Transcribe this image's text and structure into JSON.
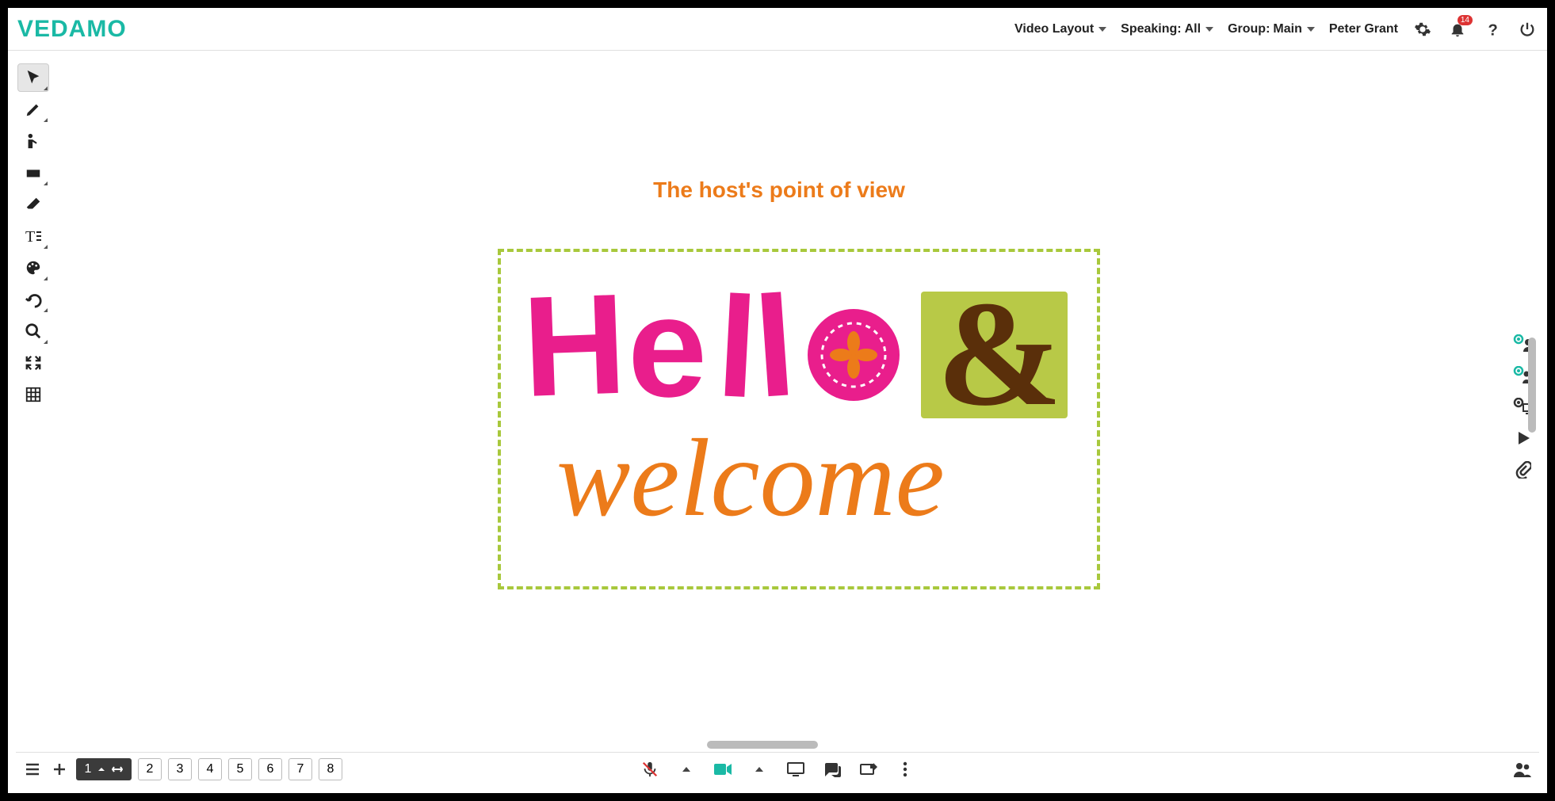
{
  "brand": "VEDAMO",
  "header": {
    "video_layout": "Video Layout",
    "speaking_label": "Speaking:",
    "speaking_value": "All",
    "group_label": "Group:",
    "group_value": "Main",
    "username": "Peter Grant",
    "notification_count": "14"
  },
  "tools": [
    {
      "name": "cursor-tool",
      "active": true
    },
    {
      "name": "pen-tool",
      "active": false
    },
    {
      "name": "pointer-tool",
      "active": false
    },
    {
      "name": "shape-tool",
      "active": false
    },
    {
      "name": "eraser-tool",
      "active": false
    },
    {
      "name": "text-tool",
      "active": false
    },
    {
      "name": "color-tool",
      "active": false
    },
    {
      "name": "undo-tool",
      "active": false
    },
    {
      "name": "zoom-tool",
      "active": false
    },
    {
      "name": "fit-tool",
      "active": false
    },
    {
      "name": "grid-tool",
      "active": false
    }
  ],
  "right_panel": [
    {
      "name": "single-user-icon"
    },
    {
      "name": "group-users-icon"
    },
    {
      "name": "screen-share-icon"
    },
    {
      "name": "play-icon"
    },
    {
      "name": "attachment-icon"
    }
  ],
  "canvas": {
    "title_text": "The host's point of view",
    "artwork_hello": "Hello",
    "artwork_amp": "&",
    "artwork_welcome": "welcome"
  },
  "pages": {
    "current": "1",
    "list": [
      "1",
      "2",
      "3",
      "4",
      "5",
      "6",
      "7",
      "8"
    ]
  },
  "bottom_controls": [
    {
      "name": "mic-muted-icon"
    },
    {
      "name": "mic-options-arrow"
    },
    {
      "name": "camera-icon"
    },
    {
      "name": "camera-options-arrow"
    },
    {
      "name": "screen-icon"
    },
    {
      "name": "chat-icon"
    },
    {
      "name": "breakout-icon"
    },
    {
      "name": "more-options-icon"
    }
  ]
}
